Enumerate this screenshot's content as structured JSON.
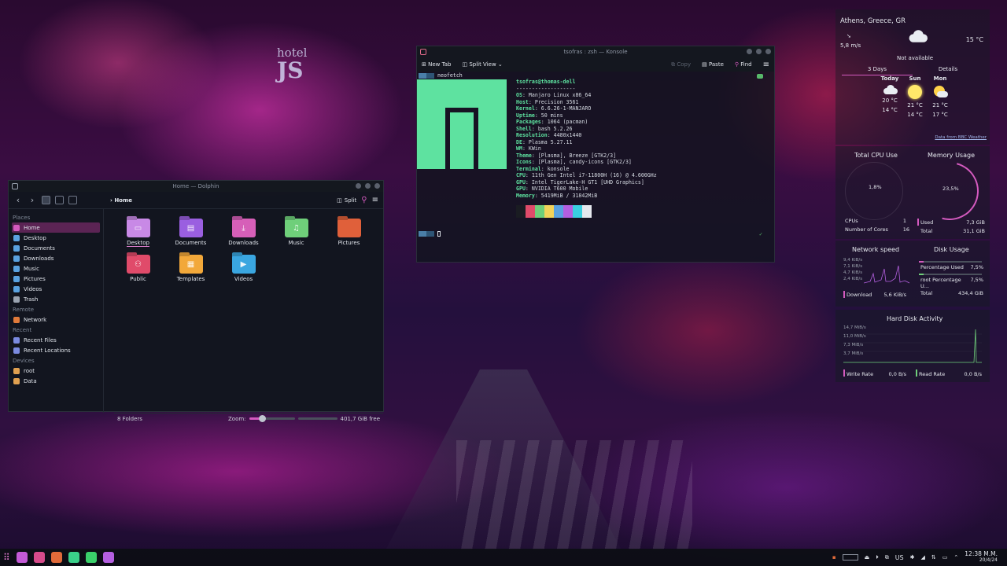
{
  "wallpaper": {
    "sign_top": "hotel",
    "sign_big": "JS"
  },
  "dolphin": {
    "title": "Home — Dolphin",
    "breadcrumb": "Home",
    "split_label": "Split",
    "places_header": "Places",
    "places": [
      {
        "label": "Home",
        "color": "#d45abf"
      },
      {
        "label": "Desktop",
        "color": "#5aa2e0"
      },
      {
        "label": "Documents",
        "color": "#5aa2e0"
      },
      {
        "label": "Downloads",
        "color": "#5aa2e0"
      },
      {
        "label": "Music",
        "color": "#5aa2e0"
      },
      {
        "label": "Pictures",
        "color": "#5aa2e0"
      },
      {
        "label": "Videos",
        "color": "#5aa2e0"
      },
      {
        "label": "Trash",
        "color": "#9aa3b0"
      }
    ],
    "remote_header": "Remote",
    "remote": [
      {
        "label": "Network",
        "color": "#e07a3a"
      }
    ],
    "recent_header": "Recent",
    "recent": [
      {
        "label": "Recent Files",
        "color": "#7a8ae0"
      },
      {
        "label": "Recent Locations",
        "color": "#7a8ae0"
      }
    ],
    "devices_header": "Devices",
    "devices": [
      {
        "label": "root",
        "color": "#e0a050"
      },
      {
        "label": "Data",
        "color": "#e0a050"
      }
    ],
    "folders": [
      {
        "label": "Desktop",
        "color": "#c889e6",
        "glyph": "▭"
      },
      {
        "label": "Documents",
        "color": "#9a5fe0",
        "glyph": "▤"
      },
      {
        "label": "Downloads",
        "color": "#d65fb8",
        "glyph": "⤓"
      },
      {
        "label": "Music",
        "color": "#6fcf7a",
        "glyph": "♫"
      },
      {
        "label": "Pictures",
        "color": "#e0603a",
        "glyph": ""
      },
      {
        "label": "Public",
        "color": "#e04b6a",
        "glyph": "⚇"
      },
      {
        "label": "Templates",
        "color": "#f2a83a",
        "glyph": "▦"
      },
      {
        "label": "Videos",
        "color": "#3aa6e0",
        "glyph": "▶"
      }
    ],
    "status_count": "8 Folders",
    "zoom_label": "Zoom:",
    "free_space": "401,7 GiB free"
  },
  "konsole": {
    "title": "tsofras : zsh — Konsole",
    "new_tab": "New Tab",
    "split_view": "Split View",
    "copy": "Copy",
    "paste": "Paste",
    "find": "Find",
    "command": "neofetch",
    "user_host": "tsofras@thomas-dell",
    "separator": "-------------------",
    "info": [
      {
        "k": "OS",
        "v": "Manjaro Linux x86_64"
      },
      {
        "k": "Host",
        "v": "Precision 3561"
      },
      {
        "k": "Kernel",
        "v": "6.6.26-1-MANJARO"
      },
      {
        "k": "Uptime",
        "v": "50 mins"
      },
      {
        "k": "Packages",
        "v": "1064 (pacman)"
      },
      {
        "k": "Shell",
        "v": "bash 5.2.26"
      },
      {
        "k": "Resolution",
        "v": "4480x1440"
      },
      {
        "k": "DE",
        "v": "Plasma 5.27.11"
      },
      {
        "k": "WM",
        "v": "KWin"
      },
      {
        "k": "Theme",
        "v": "[Plasma], Breeze [GTK2/3]"
      },
      {
        "k": "Icons",
        "v": "[Plasma], candy-icons [GTK2/3]"
      },
      {
        "k": "Terminal",
        "v": "konsole"
      },
      {
        "k": "CPU",
        "v": "11th Gen Intel i7-11800H (16) @ 4.600GHz"
      },
      {
        "k": "GPU",
        "v": "Intel TigerLake-H GT1 [UHD Graphics]"
      },
      {
        "k": "GPU",
        "v": "NVIDIA T600 Mobile"
      },
      {
        "k": "Memory",
        "v": "5419MiB / 31842MiB"
      }
    ],
    "palette": [
      "#1a1c22",
      "#e04b6a",
      "#6fcf7a",
      "#f2d35a",
      "#5aa2e0",
      "#b45fe0",
      "#3ad0e0",
      "#e5e8ee"
    ]
  },
  "weather": {
    "location": "Athens, Greece, GR",
    "temp": "15 °C",
    "wind": "5,8 m/s",
    "status": "Not available",
    "tabs": [
      "3 Days",
      "Details"
    ],
    "days": [
      {
        "name": "Today",
        "icon": "cloud",
        "high": "20 °C",
        "low": "14 °C"
      },
      {
        "name": "Sun",
        "icon": "sun",
        "high": "21 °C",
        "low": "14 °C"
      },
      {
        "name": "Mon",
        "icon": "sun-cloud",
        "high": "21 °C",
        "low": "17 °C"
      }
    ],
    "source": "Data from BBC Weather"
  },
  "cpu": {
    "title": "Total CPU Use",
    "percent": "1,8%",
    "cpus_label": "CPUs",
    "cpus": "1",
    "cores_label": "Number of Cores",
    "cores": "16"
  },
  "memory": {
    "title": "Memory Usage",
    "percent": "23,5%",
    "used_label": "Used",
    "used": "7,3 GiB",
    "total_label": "Total",
    "total": "31,1 GiB"
  },
  "network": {
    "title": "Network speed",
    "ticks": [
      "9,4 KiB/s",
      "7,1 KiB/s",
      "4,7 KiB/s",
      "2,4 KiB/s"
    ],
    "download_label": "Download",
    "download": "5,6 KiB/s"
  },
  "disk": {
    "title": "Disk Usage",
    "pct_used_label": "Percentage Used",
    "pct_used": "7,5%",
    "root_label": "root Percentage U...",
    "root": "7,5%",
    "total_label": "Total",
    "total": "434,4 GiB"
  },
  "hdd": {
    "title": "Hard Disk Activity",
    "ticks": [
      "14,7 MiB/s",
      "11,0 MiB/s",
      "7,3 MiB/s",
      "3,7 MiB/s"
    ],
    "write_label": "Write Rate",
    "write": "0,0 B/s",
    "read_label": "Read Rate",
    "read": "0,0 B/s"
  },
  "taskbar": {
    "apps": [
      {
        "name": "dolphin",
        "color": "#c35ad6"
      },
      {
        "name": "konsole",
        "color": "#d64b8a"
      },
      {
        "name": "firefox",
        "color": "#e06a3a"
      },
      {
        "name": "app-4",
        "color": "#3ad08a"
      },
      {
        "name": "spotify",
        "color": "#3ad06a"
      },
      {
        "name": "app-6",
        "color": "#b45fe0"
      }
    ],
    "keyboard": "US",
    "time": "12:38 M.M.",
    "date": "20/4/24"
  }
}
